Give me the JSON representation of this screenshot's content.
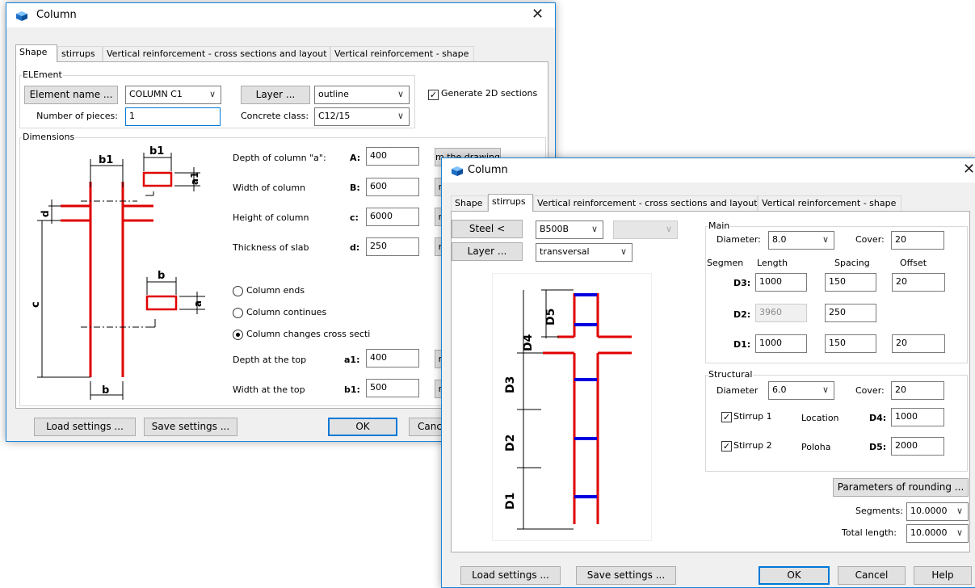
{
  "win1": {
    "title": "Column",
    "tabs": [
      "Shape",
      "stirrups",
      "Vertical reinforcement - cross sections and layout",
      "Vertical reinforcement - shape"
    ],
    "element_group": "ELEment",
    "element_name_button": "Element name ...",
    "element_name_value": "COLUMN C1",
    "layer_button": "Layer ...",
    "layer_value": "outline",
    "generate_2d": "Generate 2D sections",
    "generate_2d_checked": true,
    "num_pieces_label": "Number of pieces:",
    "num_pieces_value": "1",
    "concrete_label": "Concrete class:",
    "concrete_value": "C12/15",
    "dimensions_group": "Dimensions",
    "rows": [
      {
        "label": "Depth of column \"a\":",
        "code": "A:",
        "value": "400"
      },
      {
        "label": "Width of column",
        "code": "B:",
        "value": "600"
      },
      {
        "label": "Height of column",
        "code": "c:",
        "value": "6000"
      },
      {
        "label": "Thickness of slab",
        "code": "d:",
        "value": "250"
      }
    ],
    "from_drawing_btn": "m the drawing",
    "side_btn": "m",
    "radio_ends": "Column ends",
    "radio_continues": "Column continues",
    "radio_changes": "Column changes cross secti",
    "top_rows": [
      {
        "label": "Depth at the top",
        "code": "a1:",
        "value": "400"
      },
      {
        "label": "Width at the top",
        "code": "b1:",
        "value": "500"
      }
    ],
    "drawing_labels": {
      "b1_top": "b1",
      "b1_rect": "b1",
      "a1": "a1",
      "d": "d",
      "c": "c",
      "b_rect": "b",
      "a": "a",
      "b_bottom": "b"
    },
    "load_settings": "Load settings ...",
    "save_settings": "Save settings ...",
    "ok": "OK",
    "cancel_partial": "Canc"
  },
  "win2": {
    "title": "Column",
    "tabs": [
      "Shape",
      "stirrups",
      "Vertical reinforcement - cross sections and layout",
      "Vertical reinforcement - shape"
    ],
    "steel_button": "Steel <",
    "steel_value": "B500B",
    "layer_button": "Layer ...",
    "layer_value": "transversal",
    "main_group": "Main",
    "diameter_label": "Diameter:",
    "diameter_value": "8.0",
    "cover_label": "Cover:",
    "cover_value": "20",
    "col_segmen": "Segmen",
    "col_length": "Length",
    "col_spacing": "Spacing",
    "col_offset": "Offset",
    "segments": [
      {
        "name": "D3:",
        "length": "1000",
        "spacing": "150",
        "offset": "20"
      },
      {
        "name": "D2:",
        "length": "3960",
        "spacing": "250",
        "offset": ""
      },
      {
        "name": "D1:",
        "length": "1000",
        "spacing": "150",
        "offset": "20"
      }
    ],
    "structural_group": "Structural",
    "s_diameter_label": "Diameter",
    "s_diameter_value": "6.0",
    "s_cover_label": "Cover:",
    "s_cover_value": "20",
    "stirrup1": "Stirrup 1",
    "stirrup1_checked": true,
    "location_label": "Location",
    "d4_label": "D4:",
    "d4_value": "1000",
    "stirrup2": "Stirrup 2",
    "stirrup2_checked": true,
    "poloha_label": "Poloha",
    "d5_label": "D5:",
    "d5_value": "2000",
    "rounding_button": "Parameters of rounding ...",
    "segments_label": "Segments:",
    "segments_value": "10.0000",
    "total_length_label": "Total length:",
    "total_length_value": "10.0000",
    "drawing_labels": {
      "d5": "D5",
      "d4": "D4",
      "d3": "D3",
      "d2": "D2",
      "d1": "D1"
    },
    "load_settings": "Load settings ...",
    "save_settings": "Save settings ...",
    "ok": "OK",
    "cancel": "Cancel",
    "help": "Help"
  },
  "icons": {
    "app": "column-app-icon",
    "close": "close-icon",
    "dropdown": "chevron-down-icon"
  },
  "colors": {
    "accent": "#0078d7",
    "rebar_red": "#e00000",
    "stirrup_blue": "#0000e0"
  }
}
